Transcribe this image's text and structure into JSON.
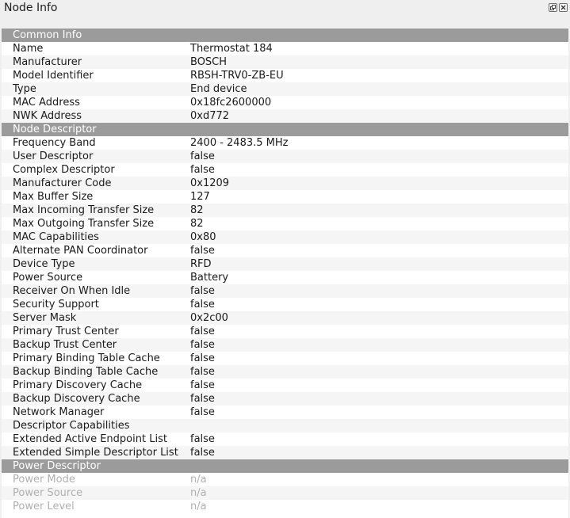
{
  "window": {
    "title": "Node Info",
    "float_icon": "float-icon",
    "close_icon": "close-icon"
  },
  "sections": [
    {
      "title": "Common Info",
      "disabled": false,
      "rows": [
        {
          "key": "Name",
          "value": "Thermostat 184"
        },
        {
          "key": "Manufacturer",
          "value": "BOSCH"
        },
        {
          "key": "Model Identifier",
          "value": "RBSH-TRV0-ZB-EU"
        },
        {
          "key": "Type",
          "value": "End device"
        },
        {
          "key": "MAC Address",
          "value": "0x18fc2600000"
        },
        {
          "key": "NWK Address",
          "value": "0xd772"
        }
      ]
    },
    {
      "title": "Node Descriptor",
      "disabled": false,
      "rows": [
        {
          "key": "Frequency Band",
          "value": "2400 - 2483.5 MHz"
        },
        {
          "key": "User Descriptor",
          "value": "false"
        },
        {
          "key": "Complex Descriptor",
          "value": "false"
        },
        {
          "key": "Manufacturer Code",
          "value": "0x1209"
        },
        {
          "key": "Max Buffer Size",
          "value": "127"
        },
        {
          "key": "Max Incoming Transfer Size",
          "value": "82"
        },
        {
          "key": "Max Outgoing Transfer Size",
          "value": "82"
        },
        {
          "key": "MAC Capabilities",
          "value": "0x80"
        },
        {
          "key": "Alternate PAN Coordinator",
          "value": "false"
        },
        {
          "key": "Device Type",
          "value": "RFD"
        },
        {
          "key": "Power Source",
          "value": "Battery"
        },
        {
          "key": "Receiver On When Idle",
          "value": "false"
        },
        {
          "key": "Security Support",
          "value": "false"
        },
        {
          "key": "Server Mask",
          "value": "0x2c00"
        },
        {
          "key": "Primary Trust Center",
          "value": "false"
        },
        {
          "key": "Backup Trust Center",
          "value": "false"
        },
        {
          "key": "Primary Binding Table Cache",
          "value": "false"
        },
        {
          "key": "Backup Binding Table Cache",
          "value": "false"
        },
        {
          "key": "Primary Discovery Cache",
          "value": "false"
        },
        {
          "key": "Backup Discovery Cache",
          "value": "false"
        },
        {
          "key": "Network Manager",
          "value": "false"
        },
        {
          "key": "Descriptor Capabilities",
          "value": ""
        },
        {
          "key": "Extended Active Endpoint List",
          "value": "false"
        },
        {
          "key": "Extended Simple Descriptor List",
          "value": "false"
        }
      ]
    },
    {
      "title": "Power Descriptor",
      "disabled": true,
      "rows": [
        {
          "key": "Power Mode",
          "value": "n/a"
        },
        {
          "key": "Power Source",
          "value": "n/a"
        },
        {
          "key": "Power Level",
          "value": "n/a"
        }
      ]
    }
  ]
}
